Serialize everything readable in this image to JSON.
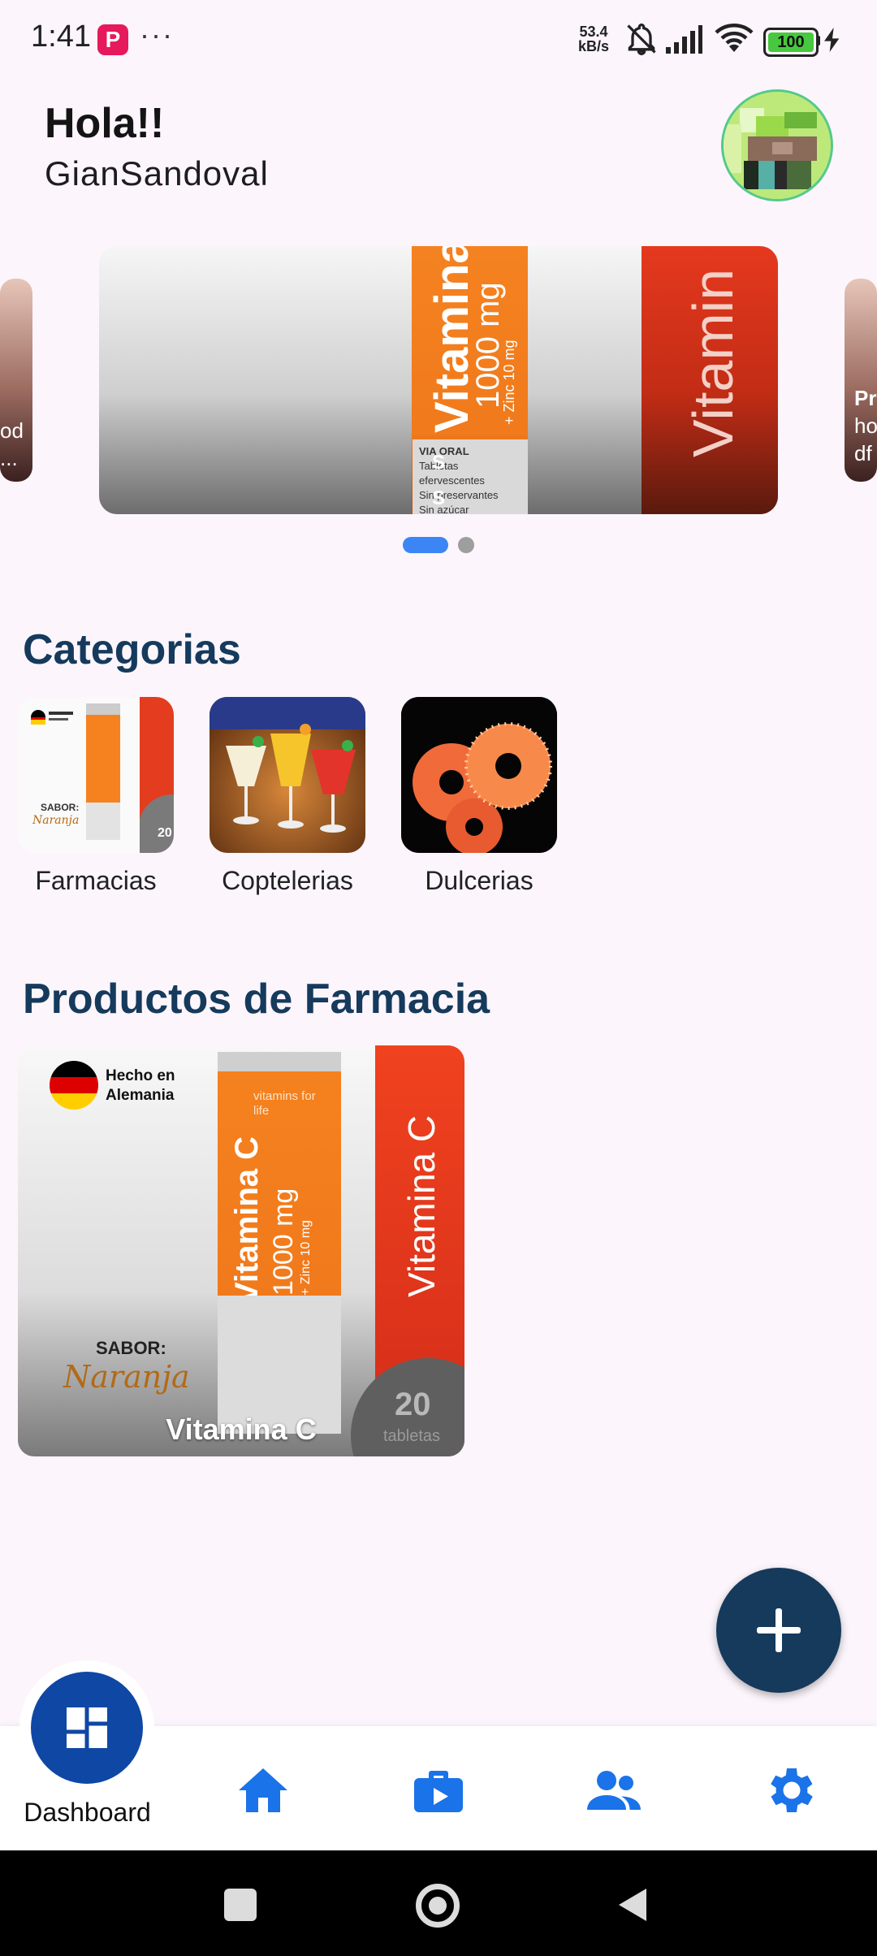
{
  "status_bar": {
    "time": "1:41",
    "app_badge": "P",
    "more": "···",
    "net_speed_top": "53.4",
    "net_speed_unit": "kB/s",
    "battery": "100"
  },
  "header": {
    "greeting": "Hola!!",
    "username": "GianSandoval"
  },
  "carousel": {
    "left_peek": [
      "od",
      "..."
    ],
    "right_peek": [
      "Pr",
      "ho",
      "df"
    ],
    "main": {
      "tube_brand": "Vitamina",
      "tube_dose": "1000 mg",
      "tube_zinc": "+ Zinc 10 mg",
      "band_text": "Vitamin",
      "label_lines": [
        "VIA ORAL",
        "Tabletas efervescentes",
        "Sin preservantes",
        "Sin azúcar"
      ],
      "overlay_chars": [
        "S",
        "S"
      ]
    },
    "active_index": 0,
    "count": 2
  },
  "categories": {
    "title": "Categorias",
    "items": [
      {
        "label": "Farmacias",
        "image": "vitamin-c-tube"
      },
      {
        "label": "Coptelerias",
        "image": "cocktails"
      },
      {
        "label": "Dulcerias",
        "image": "peach-gummies"
      }
    ]
  },
  "products": {
    "title": "Productos de Farmacia",
    "items": [
      {
        "name": "Vitamina C",
        "made_in": "Hecho en Alemania",
        "flavor_label": "SABOR:",
        "flavor": "Naranja",
        "brand": "vitamins for life",
        "tube_text": "Vitamina C",
        "dose": "1000 mg",
        "zinc": "+ Zinc 10 mg",
        "band_text": "Vitamina C",
        "count": "20",
        "count_unit": "tabletas"
      }
    ]
  },
  "fab": {
    "icon": "plus-icon"
  },
  "bottom_nav": {
    "dashboard_label": "Dashboard",
    "items": [
      {
        "name": "home",
        "icon": "home-icon"
      },
      {
        "name": "work",
        "icon": "briefcase-play-icon"
      },
      {
        "name": "users",
        "icon": "people-icon"
      },
      {
        "name": "settings",
        "icon": "gear-icon"
      }
    ]
  },
  "colors": {
    "accent": "#3b86f4",
    "title": "#153a5c",
    "nav_icon": "#1a73e8",
    "dashboard": "#0f47a5",
    "background": "#fcf5fc"
  }
}
